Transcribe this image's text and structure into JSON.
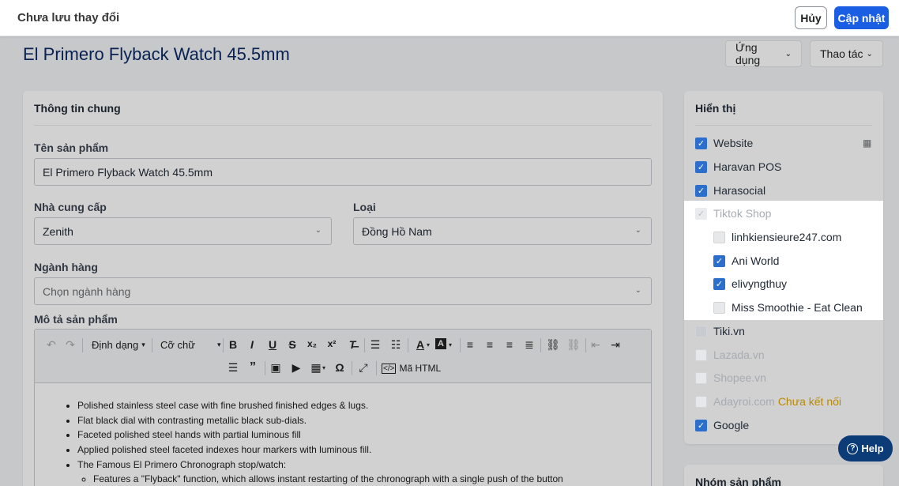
{
  "topbar": {
    "unsaved_label": "Chưa lưu thay đổi",
    "cancel_label": "Hủy",
    "save_label": "Cập nhật"
  },
  "page": {
    "title": "El Primero Flyback Watch 45.5mm",
    "apps_label": "Ứng dụng",
    "actions_label": "Thao tác"
  },
  "general": {
    "title": "Thông tin chung",
    "name_label": "Tên sản phẩm",
    "name_value": "El Primero Flyback Watch 45.5mm",
    "vendor_label": "Nhà cung cấp",
    "vendor_value": "Zenith",
    "type_label": "Loại",
    "type_value": "Đồng Hồ Nam",
    "category_label": "Ngành hàng",
    "category_placeholder": "Chọn ngành hàng",
    "desc_label": "Mô tả sản phẩm"
  },
  "toolbar": {
    "format_label": "Định dạng",
    "size_label": "Cỡ chữ",
    "html_label": "Mã HTML"
  },
  "description": {
    "items": [
      "Polished stainless steel case with fine brushed finished edges & lugs.",
      "Flat black dial with contrasting metallic black sub-dials.",
      "Faceted polished steel hands with partial luminous fill",
      "Applied polished steel faceted indexes hour markers with luminous fill.",
      "The Famous El Primero Chronograph stop/watch:"
    ],
    "sub_items": [
      "Features a \"Flyback\" function, which allows instant restarting of the chronograph with a single push of the button"
    ]
  },
  "visibility": {
    "title": "Hiển thị",
    "channels": [
      {
        "label": "Website",
        "state": "on"
      },
      {
        "label": "Haravan POS",
        "state": "on"
      },
      {
        "label": "Harasocial",
        "state": "on"
      },
      {
        "label": "Tiktok Shop",
        "state": "disabled"
      },
      {
        "label": "linhkiensieure247.com",
        "state": "off"
      },
      {
        "label": "Ani World",
        "state": "on"
      },
      {
        "label": "elivyngthuy",
        "state": "on"
      },
      {
        "label": "Miss Smoothie - Eat Clean",
        "state": "off"
      },
      {
        "label": "Tiki.vn",
        "state": "off"
      },
      {
        "label": "Lazada.vn",
        "state": "off"
      },
      {
        "label": "Shopee.vn",
        "state": "off"
      },
      {
        "label": "Adayroi.com",
        "state": "off",
        "note": "Chưa kết nối"
      },
      {
        "label": "Google",
        "state": "on"
      }
    ]
  },
  "group": {
    "title": "Nhóm sản phẩm"
  },
  "help": {
    "label": "Help"
  },
  "colors": {
    "primary": "#1a5fe3",
    "checkbox": "#2c6ecb",
    "title": "#0c2a66",
    "warning": "#b98900",
    "help_bg": "#0c3c78"
  }
}
